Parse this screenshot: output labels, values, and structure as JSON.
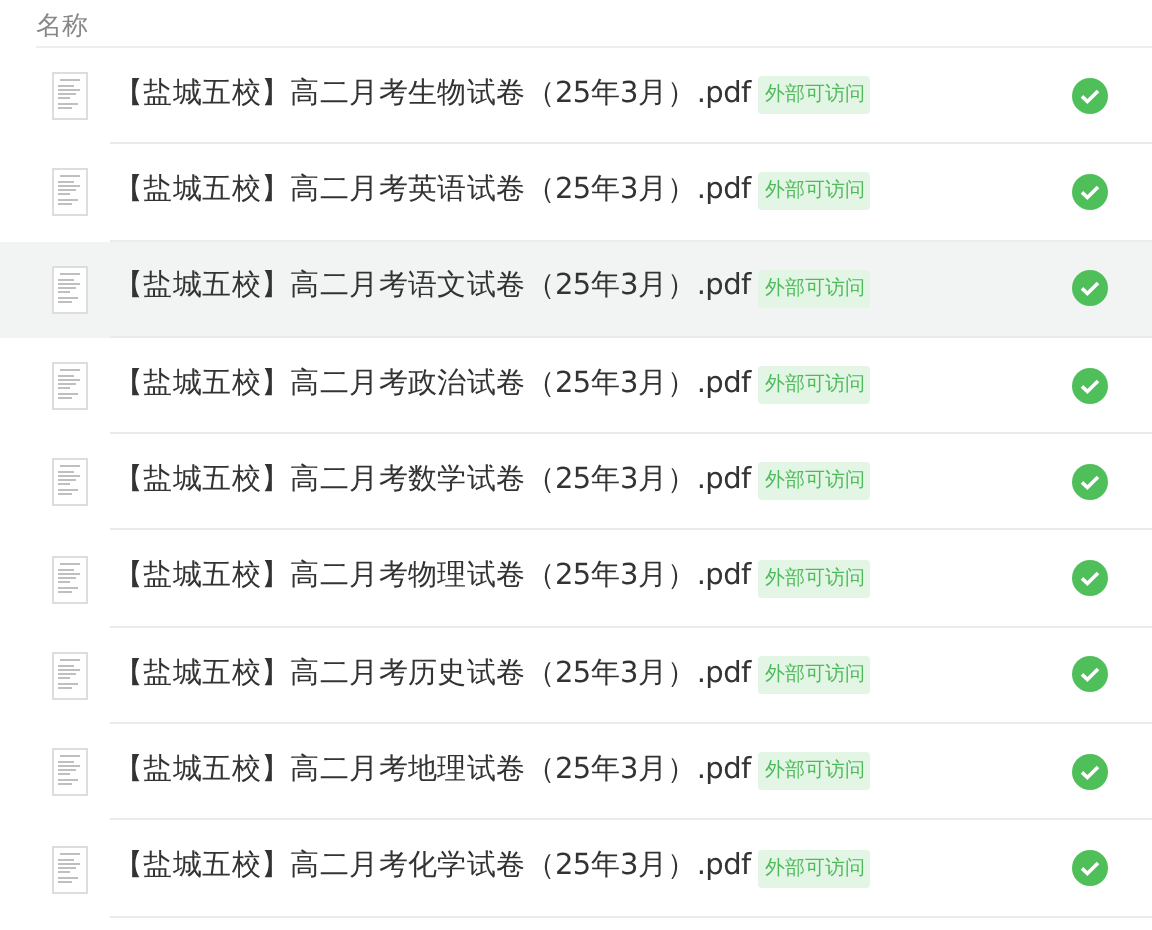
{
  "header": {
    "column_1": "名称"
  },
  "files": [
    {
      "name": "【盐城五校】高二月考生物试卷（25年3月）.pdf",
      "tag": "外部可访问",
      "highlighted": false
    },
    {
      "name": "【盐城五校】高二月考英语试卷（25年3月）.pdf",
      "tag": "外部可访问",
      "highlighted": false
    },
    {
      "name": "【盐城五校】高二月考语文试卷（25年3月）.pdf",
      "tag": "外部可访问",
      "highlighted": true
    },
    {
      "name": "【盐城五校】高二月考政治试卷（25年3月）.pdf",
      "tag": "外部可访问",
      "highlighted": false
    },
    {
      "name": "【盐城五校】高二月考数学试卷（25年3月）.pdf",
      "tag": "外部可访问",
      "highlighted": false
    },
    {
      "name": "【盐城五校】高二月考物理试卷（25年3月）.pdf",
      "tag": "外部可访问",
      "highlighted": false
    },
    {
      "name": "【盐城五校】高二月考历史试卷（25年3月）.pdf",
      "tag": "外部可访问",
      "highlighted": false
    },
    {
      "name": "【盐城五校】高二月考地理试卷（25年3月）.pdf",
      "tag": "外部可访问",
      "highlighted": false
    },
    {
      "name": "【盐城五校】高二月考化学试卷（25年3月）.pdf",
      "tag": "外部可访问",
      "highlighted": false
    }
  ]
}
